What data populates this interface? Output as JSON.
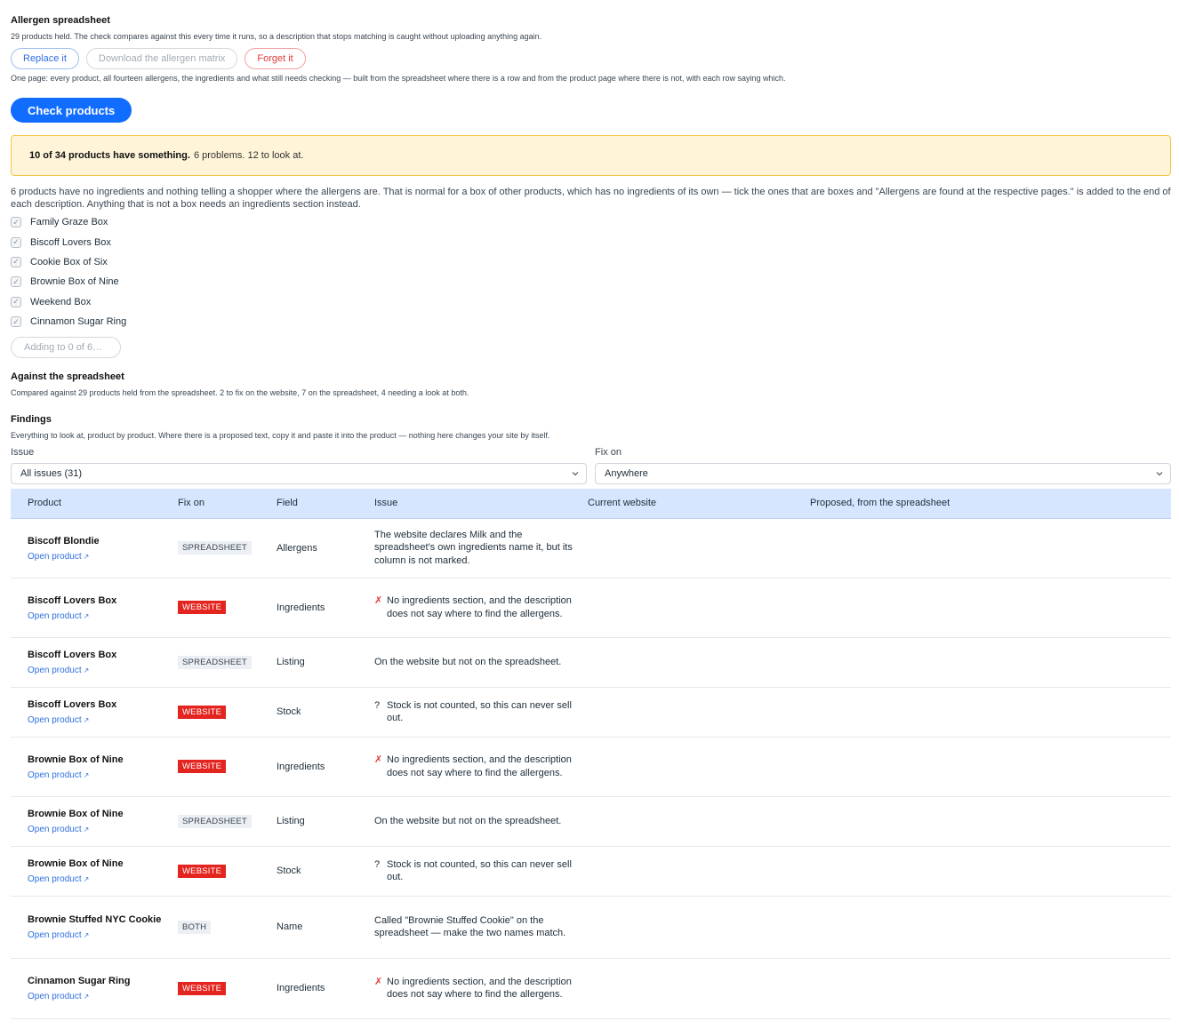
{
  "allergen": {
    "title": "Allergen spreadsheet",
    "held_text": "29 products held. The check compares against this every time it runs, so a description that stops matching is caught without uploading anything again.",
    "buttons": {
      "replace": "Replace it",
      "download": "Download the allergen matrix",
      "forget": "Forget it"
    },
    "page_note": "One page: every product, all fourteen allergens, the ingredients and what still needs checking — built from the spreadsheet where there is a row and from the product page where there is not, with each row saying which."
  },
  "check_button": "Check products",
  "summary": {
    "bold": "10 of 34 products have something.",
    "rest": "6 problems. 12 to look at."
  },
  "boxes": {
    "intro": "6 products have no ingredients and nothing telling a shopper where the allergens are. That is normal for a box of other products, which has no ingredients of its own — tick the ones that are boxes and \"Allergens are found at the respective pages.\" is added to the end of each description. Anything that is not a box needs an ingredients section instead.",
    "items": [
      {
        "label": "Family Graze Box",
        "checked": true
      },
      {
        "label": "Biscoff Lovers Box",
        "checked": true
      },
      {
        "label": "Cookie Box of Six",
        "checked": true
      },
      {
        "label": "Brownie Box of Nine",
        "checked": true
      },
      {
        "label": "Weekend Box",
        "checked": true
      },
      {
        "label": "Cinnamon Sugar Ring",
        "checked": true
      }
    ],
    "adding_label": "Adding to 0 of 6…"
  },
  "against": {
    "title": "Against the spreadsheet",
    "text": "Compared against 29 products held from the spreadsheet. 2 to fix on the website, 7 on the spreadsheet, 4 needing a look at both."
  },
  "findings": {
    "title": "Findings",
    "text": "Everything to look at, product by product. Where there is a proposed text, copy it and paste it into the product — nothing here changes your site by itself.",
    "filters": {
      "issue_label": "Issue",
      "issue_value": "All issues (31)",
      "fixon_label": "Fix on",
      "fixon_value": "Anywhere"
    },
    "columns": [
      "Product",
      "Fix on",
      "Field",
      "Issue",
      "Current website",
      "Proposed, from the spreadsheet"
    ],
    "link_label": "Open product",
    "link_icon": "external-link-icon",
    "rows": [
      {
        "product": "Biscoff Blondie",
        "fix": "SPREADSHEET",
        "kind": "sheet",
        "field": "Allergens",
        "mark": "",
        "issue": "The website declares Milk and the spreadsheet's own ingredients name it, but its column is not marked.",
        "current": "",
        "proposed": ""
      },
      {
        "product": "Biscoff Lovers Box",
        "fix": "WEBSITE",
        "kind": "web",
        "field": "Ingredients",
        "mark": "✗",
        "issue": "No ingredients section, and the description does not say where to find the allergens.",
        "current": "",
        "proposed": ""
      },
      {
        "product": "Biscoff Lovers Box",
        "fix": "SPREADSHEET",
        "kind": "sheet",
        "field": "Listing",
        "mark": "",
        "issue": "On the website but not on the spreadsheet.",
        "current": "",
        "proposed": ""
      },
      {
        "product": "Biscoff Lovers Box",
        "fix": "WEBSITE",
        "kind": "web",
        "field": "Stock",
        "mark": "?",
        "issue": "Stock is not counted, so this can never sell out.",
        "current": "",
        "proposed": ""
      },
      {
        "product": "Brownie Box of Nine",
        "fix": "WEBSITE",
        "kind": "web",
        "field": "Ingredients",
        "mark": "✗",
        "issue": "No ingredients section, and the description does not say where to find the allergens.",
        "current": "",
        "proposed": ""
      },
      {
        "product": "Brownie Box of Nine",
        "fix": "SPREADSHEET",
        "kind": "sheet",
        "field": "Listing",
        "mark": "",
        "issue": "On the website but not on the spreadsheet.",
        "current": "",
        "proposed": ""
      },
      {
        "product": "Brownie Box of Nine",
        "fix": "WEBSITE",
        "kind": "web",
        "field": "Stock",
        "mark": "?",
        "issue": "Stock is not counted, so this can never sell out.",
        "current": "",
        "proposed": ""
      },
      {
        "product": "Brownie Stuffed NYC Cookie",
        "fix": "BOTH",
        "kind": "both",
        "field": "Name",
        "mark": "",
        "issue": "Called \"Brownie Stuffed Cookie\" on the spreadsheet — make the two names match.",
        "current": "",
        "proposed": ""
      },
      {
        "product": "Cinnamon Sugar Ring",
        "fix": "WEBSITE",
        "kind": "web",
        "field": "Ingredients",
        "mark": "✗",
        "issue": "No ingredients section, and the description does not say where to find the allergens.",
        "current": "",
        "proposed": ""
      }
    ]
  },
  "colors": {
    "primary": "#116dff",
    "banner_bg": "#fff4d8",
    "banner_border": "#f2c84b",
    "website_tag": "#e3241f",
    "header_bg": "#d6e6fe",
    "link": "#2f6fdf"
  }
}
